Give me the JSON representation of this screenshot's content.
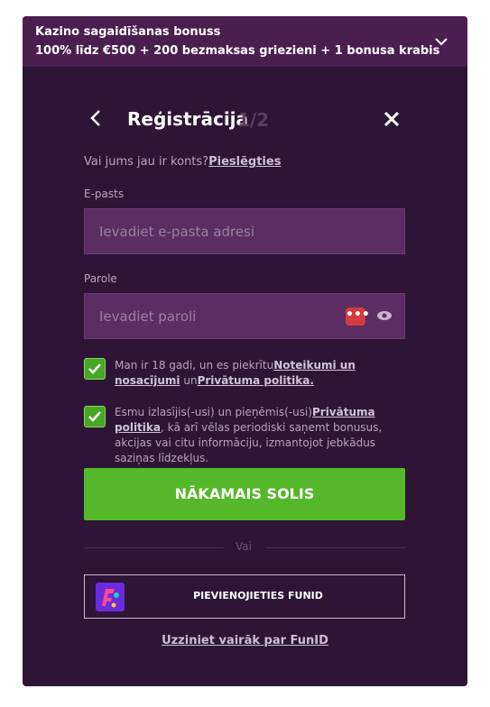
{
  "bonus": {
    "title": "Kazino sagaidīšanas bonuss",
    "subtitle": "100% līdz €500 + 200 bezmaksas griezieni + 1 bonusa krabis"
  },
  "modal": {
    "title": "Reģistrācija",
    "step": "1/2"
  },
  "account": {
    "question": "Vai jums jau ir konts?",
    "login_link": "Pieslēgties"
  },
  "email": {
    "label": "E-pasts",
    "placeholder": "Ievadiet e-pasta adresi"
  },
  "password": {
    "label": "Parole",
    "placeholder": "Ievadiet paroli",
    "manager_icon": "•••"
  },
  "consent1": {
    "text_before": "Man ir 18 gadi, un es piekrītu",
    "terms_link": "Noteikumi un nosacījumi",
    "text_middle": " un",
    "privacy_link": "Privātuma politika."
  },
  "consent2": {
    "text_before": "Esmu izlasījis(-usi) un pieņēmis(-usi)",
    "privacy_link": "Privātuma politika",
    "text_after": ", kā arī vēlas periodiski saņemt bonusus, akcijas vai citu informāciju, izmantojot jebkādus saziņas līdzekļus."
  },
  "next_button": "NĀKAMAIS SOLIS",
  "divider_text": "Vai",
  "funid_button": "PIEVIENOJIETIES FUNID",
  "learn_more": "Uzziniet vairāk par FunID",
  "colors": {
    "panel_bg": "#2e1536",
    "bonus_bg": "#4a1e4f",
    "accent_green": "#55b82a",
    "field_bg": "#5b2d63"
  }
}
